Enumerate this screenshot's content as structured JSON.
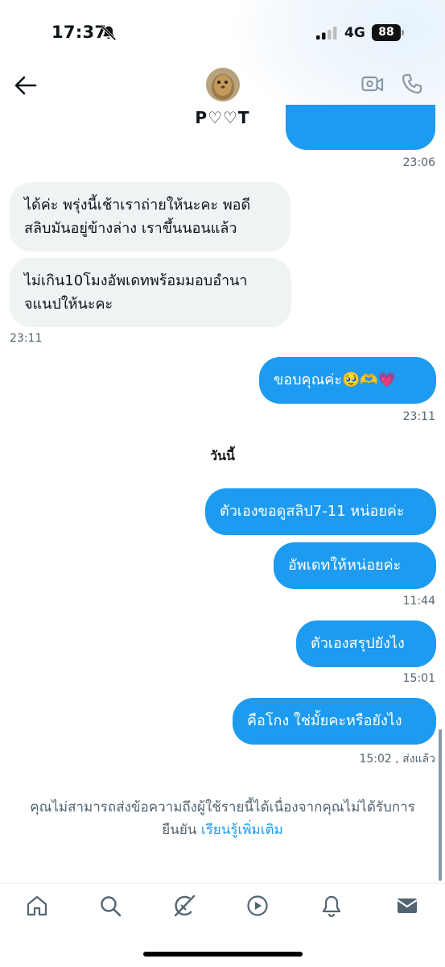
{
  "status_bar": {
    "time": "17:37",
    "network": "4G",
    "battery": "88"
  },
  "header": {
    "contact_name": "P♡♡T"
  },
  "messages": [
    {
      "direction": "out",
      "text": "",
      "time": "23:06"
    },
    {
      "direction": "in",
      "lines": [
        "ได้ค่ะ พรุ่งนี้เช้าเราถ่ายให้นะคะ พอดี",
        "สลิบมันอยู่ข้างล่าง เราขึ้นนอนแล้ว"
      ]
    },
    {
      "direction": "in",
      "lines": [
        "ไม่เกิน10โมงอัพเดทพร้อมมอบอำนา",
        "จแนปให้นะคะ"
      ],
      "time": "23:11"
    },
    {
      "direction": "out",
      "text": "ขอบคุณค่ะ",
      "emoji": "🥹🫶💗",
      "time": "23:11"
    },
    {
      "direction": "separator",
      "text": "วันนี้"
    },
    {
      "direction": "out",
      "text": "ตัวเองขอดูสลิป7-11 หน่อยค่ะ"
    },
    {
      "direction": "out",
      "text": "อัพเดทให้หน่อยค่ะ",
      "time": "11:44"
    },
    {
      "direction": "out",
      "text": "ตัวเองสรุปยังไง",
      "time": "15:01"
    },
    {
      "direction": "out",
      "text": "คือโกง ใช่มั้ยคะหรือยังไง",
      "time": "15:02 , ส่งแล้ว"
    }
  ],
  "notice": {
    "text": "คุณไม่สามารถส่งข้อความถึงผู้ใช้รายนี้ได้เนื่องจากคุณไม่ได้รับการ",
    "text2": "ยืนยัน",
    "link": "เรียนรู้เพิ่มเติม"
  },
  "bottom_nav": {
    "items": [
      "home-icon",
      "search-icon",
      "grok-icon",
      "video-icon",
      "notifications-icon",
      "messages-icon"
    ]
  },
  "colors": {
    "accent": "#1d9bf0",
    "incoming_bubble": "#eff3f4",
    "muted_text": "#536471"
  }
}
